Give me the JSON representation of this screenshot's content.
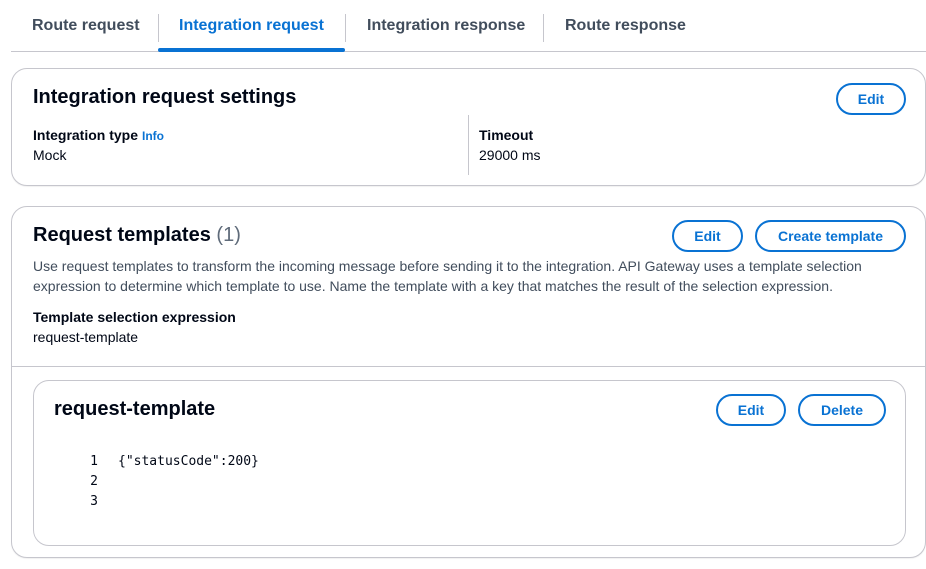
{
  "tabs": [
    {
      "label": "Route request",
      "active": false
    },
    {
      "label": "Integration request",
      "active": true
    },
    {
      "label": "Integration response",
      "active": false
    },
    {
      "label": "Route response",
      "active": false
    }
  ],
  "settings": {
    "title": "Integration request settings",
    "edit_label": "Edit",
    "integration_type_label": "Integration type",
    "info_label": "Info",
    "integration_type_value": "Mock",
    "timeout_label": "Timeout",
    "timeout_value": "29000 ms"
  },
  "templates": {
    "title": "Request templates",
    "count": "(1)",
    "edit_label": "Edit",
    "create_label": "Create template",
    "description_line1": "Use request templates to transform the incoming message before sending it to the integration. API Gateway uses a template selection",
    "description_line2": "expression to determine which template to use. Name the template with a key that matches the result of the selection expression.",
    "selection_label": "Template selection expression",
    "selection_value": "request-template"
  },
  "template_item": {
    "title": "request-template",
    "edit_label": "Edit",
    "delete_label": "Delete",
    "lines": [
      {
        "num": "1",
        "text": "{\"statusCode\":200}"
      },
      {
        "num": "2",
        "text": ""
      },
      {
        "num": "3",
        "text": ""
      }
    ]
  },
  "colors": {
    "accent": "#0972d3",
    "text": "#000716",
    "border": "#c6c6cd"
  }
}
